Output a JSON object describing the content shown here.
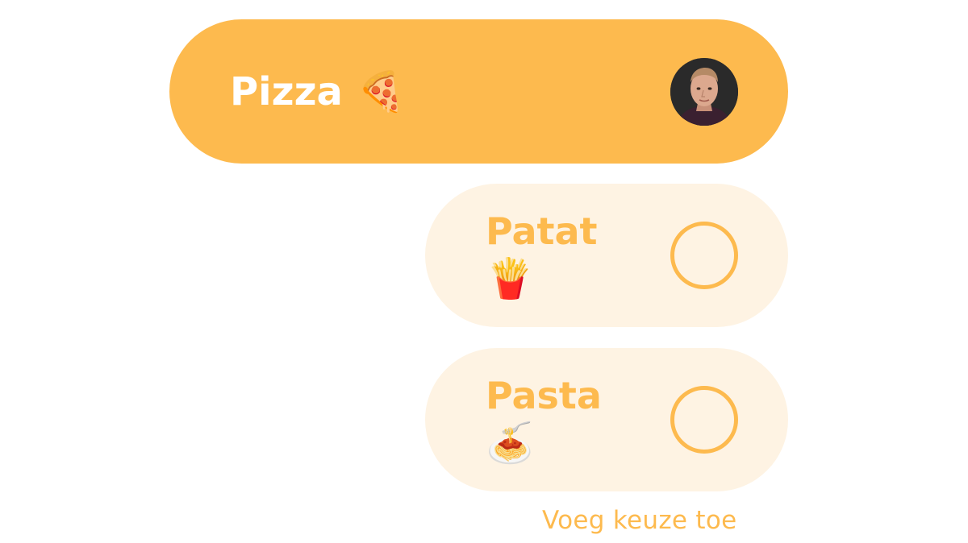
{
  "accent_color": "#FDBA4E",
  "unselected_background": "#FEF3E3",
  "options": [
    {
      "label": "Pizza",
      "emoji": "🍕",
      "selected": true,
      "voter_avatar": "user-avatar"
    },
    {
      "label": "Patat",
      "emoji": "🍟",
      "selected": false
    },
    {
      "label": "Pasta",
      "emoji": "🍝",
      "selected": false
    }
  ],
  "add_choice_label": "Voeg keuze toe"
}
